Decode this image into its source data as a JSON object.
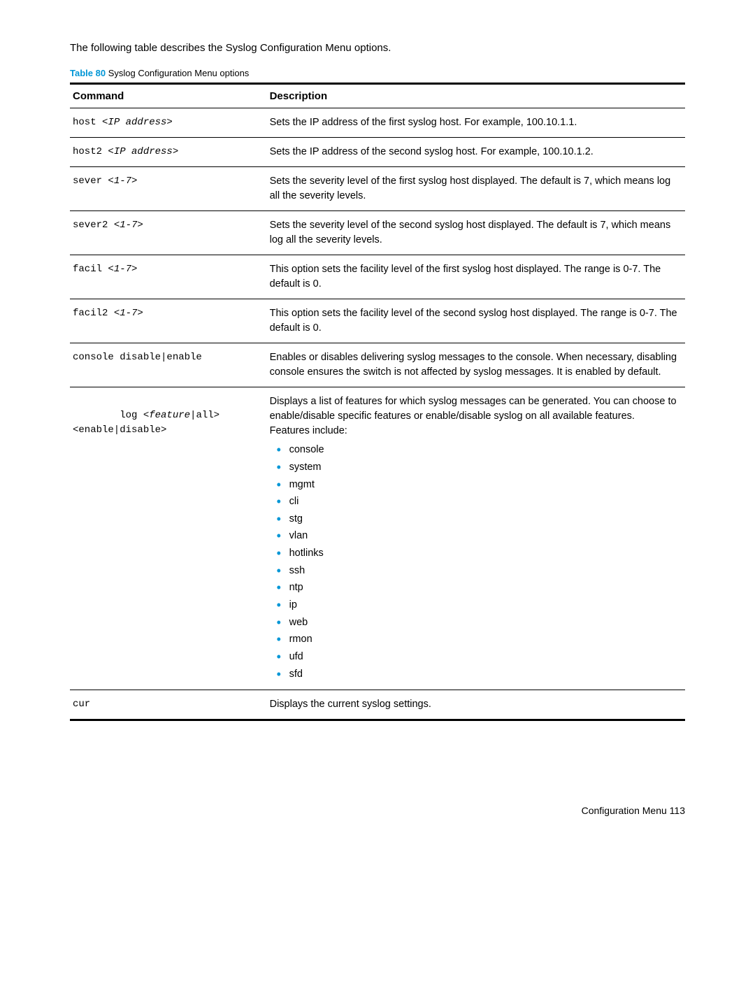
{
  "intro": "The following table describes the Syslog Configuration Menu options.",
  "caption_label": "Table 80",
  "caption_text": "Syslog Configuration Menu options",
  "headers": {
    "command": "Command",
    "description": "Description"
  },
  "rows": [
    {
      "cmd_base": "host ",
      "cmd_arg": "<IP address>",
      "desc": "Sets the IP address of the first syslog host. For example, 100.10.1.1."
    },
    {
      "cmd_base": "host2 ",
      "cmd_arg": "<IP address>",
      "desc": "Sets the IP address of the second syslog host. For example, 100.10.1.2."
    },
    {
      "cmd_base": "sever ",
      "cmd_arg": "<1-7>",
      "desc": "Sets the severity level of the first syslog host displayed. The default is 7, which means log all the severity levels."
    },
    {
      "cmd_base": "sever2 ",
      "cmd_arg": "<1-7>",
      "desc": "Sets the severity level of the second syslog host displayed. The default is 7, which means log all the severity levels."
    },
    {
      "cmd_base": "facil ",
      "cmd_arg": "<1-7>",
      "desc": "This option sets the facility level of the first syslog host displayed. The range is 0-7. The default is 0."
    },
    {
      "cmd_base": "facil2 ",
      "cmd_arg": "<1-7>",
      "desc": "This option sets the facility level of the second syslog host displayed. The range is 0-7. The default is 0."
    },
    {
      "cmd_base": "console disable|enable",
      "cmd_arg": "",
      "desc": "Enables or disables delivering syslog messages to the console. When necessary, disabling console ensures the switch is not affected by syslog messages. It is enabled by default."
    }
  ],
  "log_row": {
    "cmd_l1_base": "log ",
    "cmd_l1_arg": "<feature",
    "cmd_l1_tail": "|all>",
    "cmd_l2": "<enable|disable>",
    "desc_main": "Displays a list of features for which syslog messages can be generated. You can choose to enable/disable specific features or enable/disable syslog on all available features.",
    "features_label": "Features include:",
    "features": [
      "console",
      "system",
      "mgmt",
      "cli",
      "stg",
      "vlan",
      "hotlinks",
      "ssh",
      "ntp",
      "ip",
      "web",
      "rmon",
      "ufd",
      "sfd"
    ]
  },
  "cur_row": {
    "cmd": "cur",
    "desc": "Displays the current syslog settings."
  },
  "footer_text": "Configuration Menu   113"
}
